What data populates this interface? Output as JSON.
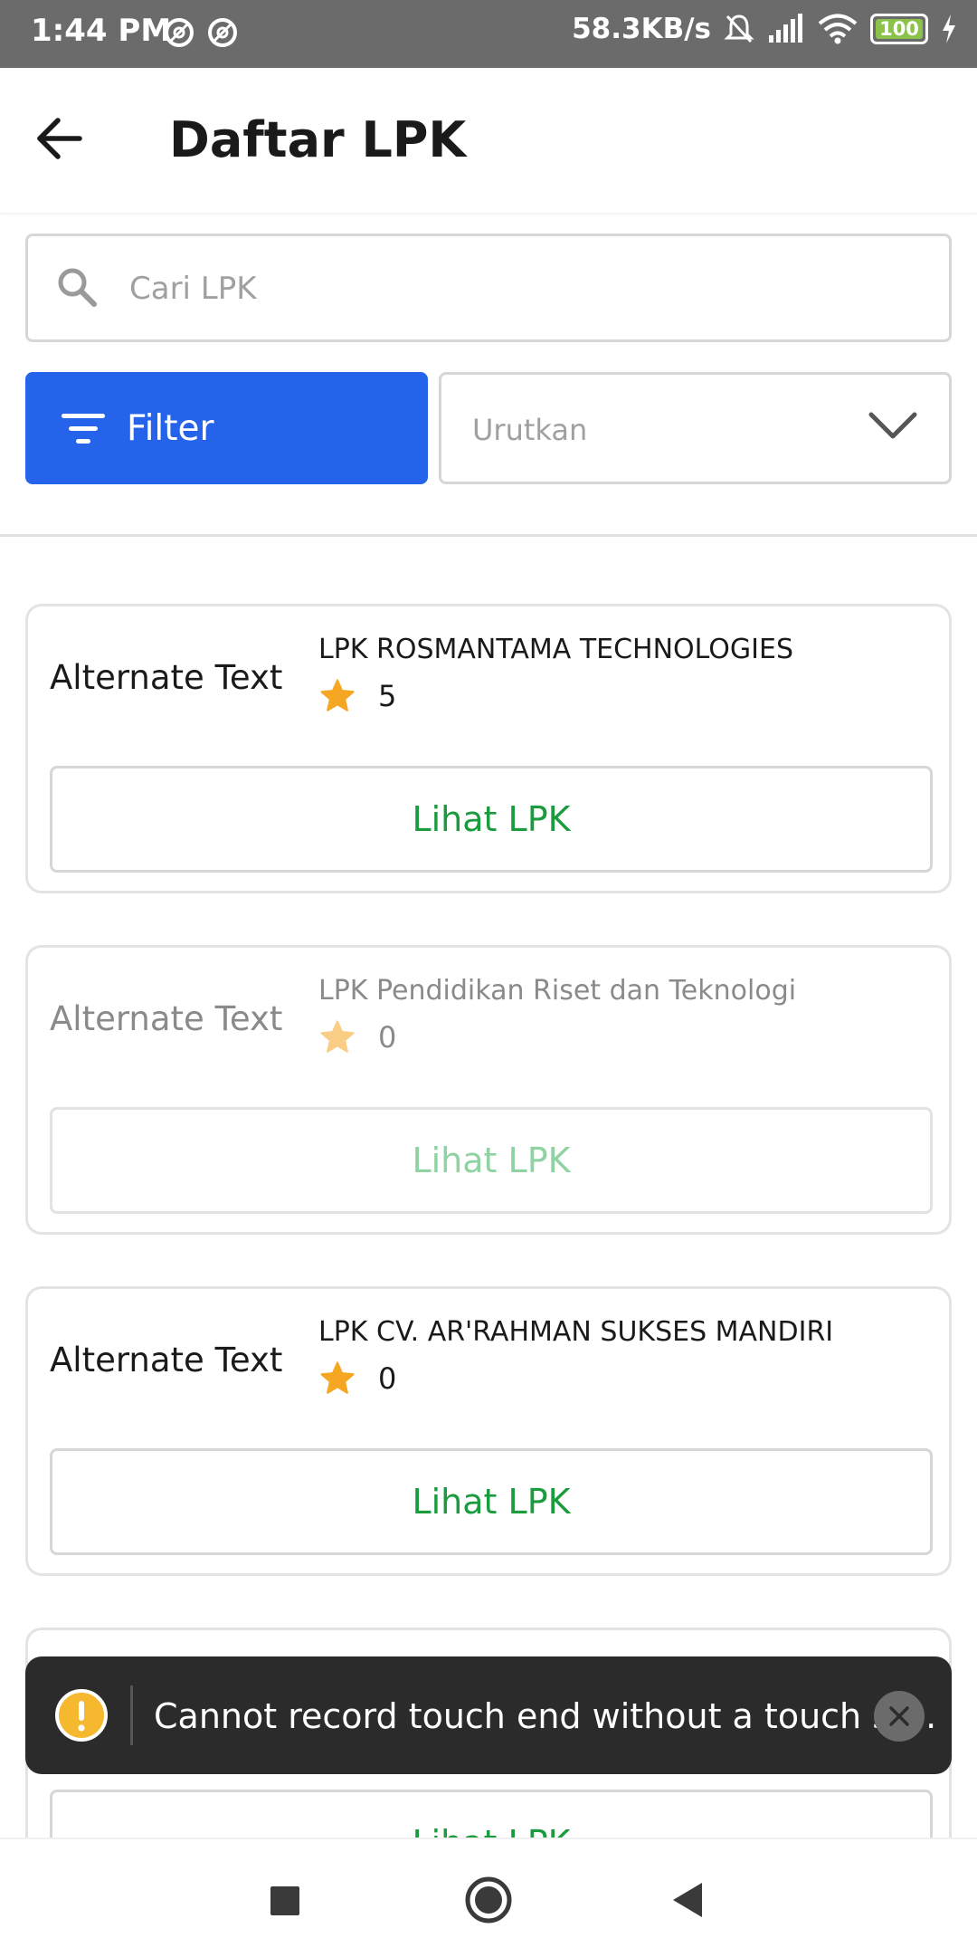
{
  "status_bar": {
    "time": "1:44 PM",
    "speed": "58.3KB/s",
    "battery": "100"
  },
  "app_bar": {
    "title": "Daftar LPK"
  },
  "search": {
    "placeholder": "Cari LPK"
  },
  "filter": {
    "label": "Filter"
  },
  "sort": {
    "label": "Urutkan"
  },
  "lpk_list": [
    {
      "alt": "Alternate Text",
      "name": "LPK ROSMANTAMA TECHNOLOGIES",
      "rating": "5",
      "button": "Lihat LPK"
    },
    {
      "alt": "Alternate Text",
      "name": "LPK Pendidikan Riset dan Teknologi",
      "rating": "0",
      "button": "Lihat LPK"
    },
    {
      "alt": "Alternate Text",
      "name": "LPK CV. AR'RAHMAN SUKSES MANDIRI",
      "rating": "0",
      "button": "Lihat LPK"
    },
    {
      "button": "Lihat LPK"
    }
  ],
  "toast": {
    "message": "Cannot record touch end without a touch st..."
  },
  "colors": {
    "primary": "#2563eb",
    "accent_green": "#1a9c3e",
    "star": "#f5a623"
  }
}
